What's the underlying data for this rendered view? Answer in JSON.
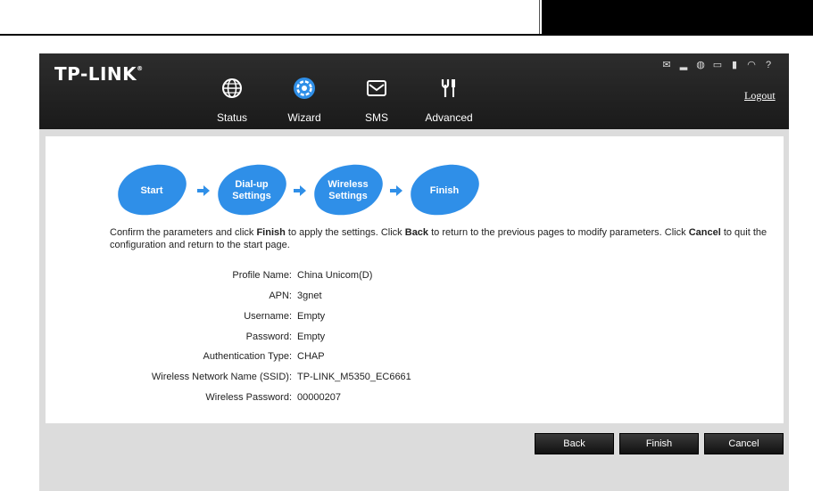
{
  "brand": {
    "logo": "TP-LINK"
  },
  "nav": {
    "items": [
      {
        "label": "Status",
        "icon": "globe-icon"
      },
      {
        "label": "Wizard",
        "icon": "wizard-gear-icon",
        "active": true
      },
      {
        "label": "SMS",
        "icon": "envelope-icon"
      },
      {
        "label": "Advanced",
        "icon": "tools-icon"
      }
    ],
    "logout": "Logout"
  },
  "status_icons": [
    "message-icon",
    "signal-icon",
    "globe-status-icon",
    "battery-icon",
    "sim-icon",
    "wifi-icon",
    "help-icon"
  ],
  "steps": [
    "Start",
    "Dial-up\nSettings",
    "Wireless\nSettings",
    "Finish"
  ],
  "step_color": "#2f8fe8",
  "instruction": {
    "p1": "Confirm the parameters and click ",
    "b1": "Finish",
    "p2": " to apply the settings. Click ",
    "b2": "Back",
    "p3": " to return to the previous pages to modify parameters. Click ",
    "b3": "Cancel",
    "p4": " to quit the configuration and return to the start page."
  },
  "summary": [
    {
      "key": "Profile Name:",
      "value": "China Unicom(D)"
    },
    {
      "key": "APN:",
      "value": "3gnet"
    },
    {
      "key": "Username:",
      "value": "Empty"
    },
    {
      "key": "Password:",
      "value": "Empty"
    },
    {
      "key": "Authentication Type:",
      "value": "CHAP"
    },
    {
      "key": "Wireless Network Name (SSID):",
      "value": "TP-LINK_M5350_EC6661"
    },
    {
      "key": "Wireless Password:",
      "value": "00000207"
    }
  ],
  "buttons": {
    "back": "Back",
    "finish": "Finish",
    "cancel": "Cancel"
  }
}
